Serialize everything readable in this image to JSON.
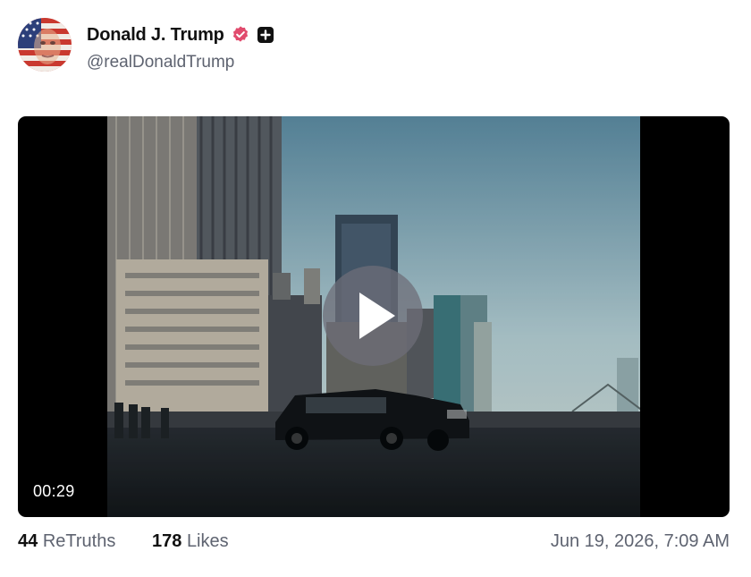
{
  "post": {
    "author": {
      "display_name": "Donald J. Trump",
      "handle": "@realDonaldTrump",
      "verified_icon": "verified-badge-icon",
      "plus_icon": "plus-badge-icon",
      "avatar_icon": "avatar-flag-portrait"
    },
    "video": {
      "duration": "00:29",
      "play_icon": "play-icon"
    },
    "stats": {
      "retruths_count": "44",
      "retruths_label": "ReTruths",
      "likes_count": "178",
      "likes_label": "Likes"
    },
    "timestamp": "Jun 19, 2026, 7:09 AM"
  },
  "colors": {
    "verified": "#e14b6d",
    "text_primary": "#111111",
    "text_secondary": "#5e6370",
    "video_bg": "#000000"
  }
}
